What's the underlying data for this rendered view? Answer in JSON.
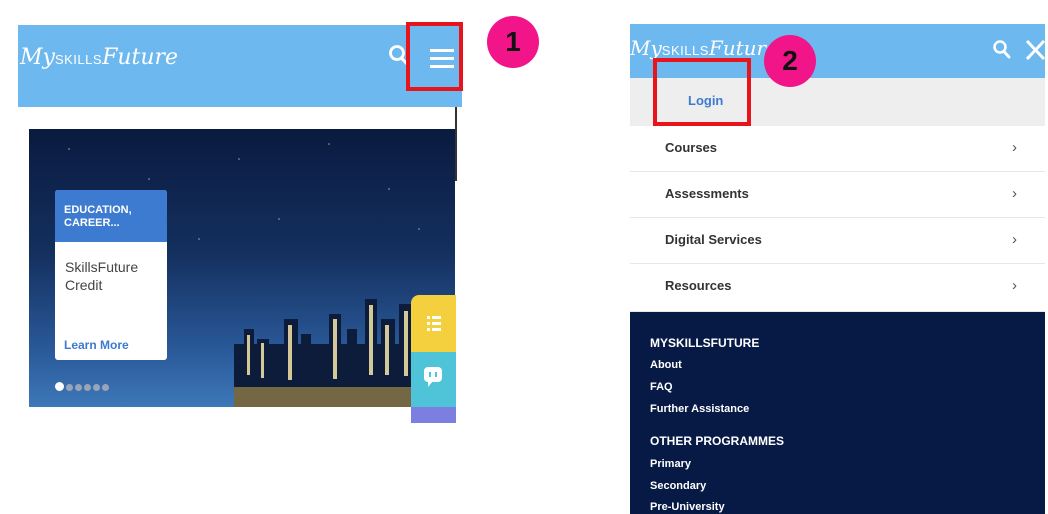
{
  "left": {
    "logo_script": "My",
    "logo_caps": "SKILLS",
    "logo_tail": "Future",
    "hero_card": {
      "category": "EDUCATION, CAREER...",
      "title": "SkillsFuture Credit",
      "link": "Learn More"
    },
    "carousel_dots": 6,
    "active_dot": 1
  },
  "annotations": {
    "step1": "1",
    "step2": "2",
    "highlight_color": "#e8141c",
    "badge_color": "#f2158a"
  },
  "right": {
    "logo_script": "My",
    "logo_caps": "SKILLS",
    "logo_tail": "Future",
    "login": "Login",
    "menu": [
      {
        "label": "Courses",
        "icon": "chevron-right-icon"
      },
      {
        "label": "Assessments",
        "icon": "chevron-right-icon"
      },
      {
        "label": "Digital Services",
        "icon": "chevron-right-icon"
      },
      {
        "label": "Resources",
        "icon": "chevron-right-icon"
      }
    ],
    "footer": {
      "section1_title": "MYSKILLSFUTURE",
      "section1_links": [
        "About",
        "FAQ",
        "Further Assistance"
      ],
      "section2_title": "OTHER PROGRAMMES",
      "section2_links": [
        "Primary",
        "Secondary",
        "Pre-University"
      ]
    }
  },
  "colors": {
    "header": "#6db8ef",
    "accent": "#3d7bd0",
    "footer": "#071a45"
  }
}
